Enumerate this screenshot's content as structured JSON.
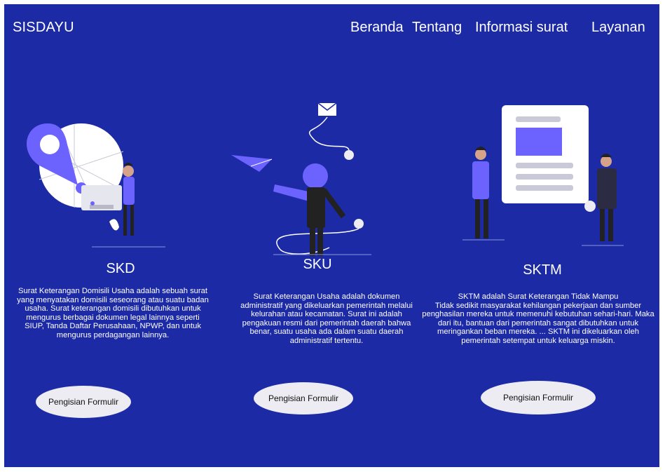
{
  "header": {
    "brand": "SISDAYU",
    "nav": {
      "beranda": "Beranda",
      "tentang": "Tentang",
      "informasi": "Informasi surat",
      "layanan": "Layanan"
    }
  },
  "cards": [
    {
      "title": "SKD",
      "lines": [
        "Surat Keterangan Domisili Usaha adalah sebuah surat",
        "yang menyatakan domisili seseorang atau suatu badan",
        "usaha. Surat keterangan domisili dibutuhkan untuk",
        "mengurus berbagai dokumen legal lainnya seperti",
        "SIUP, Tanda Daftar Perusahaan, NPWP, dan untuk",
        "mengurus perdagangan lainnya."
      ],
      "button": "Pengisian Formulir"
    },
    {
      "title": "SKU",
      "lines": [
        "Surat Keterangan Usaha adalah dokumen",
        "administratif yang dikeluarkan pemerintah melalui",
        "kelurahan atau kecamatan. Surat ini adalah",
        "pengakuan resmi dari pemerintah daerah bahwa",
        "benar, suatu usaha ada dalam suatu daerah",
        "administratif tertentu."
      ],
      "button": "Pengisian Formulir"
    },
    {
      "title": "SKTM",
      "lines": [
        "SKTM adalah Surat Keterangan Tidak Mampu",
        "Tidak sedikit masyarakat kehilangan pekerjaan dan sumber",
        "penghasilan mereka untuk memenuhi kebutuhan sehari-hari. Maka",
        "dari itu, bantuan dari pemerintah sangat dibutuhkan untuk",
        "meringankan beban mereka. ... SKTM ini dikeluarkan oleh",
        "pemerintah setempat untuk keluarga miskin."
      ],
      "button": "Pengisian Formulir"
    }
  ],
  "colors": {
    "background": "#1c2aa6",
    "accent": "#6c63ff",
    "button": "#ececf2"
  }
}
